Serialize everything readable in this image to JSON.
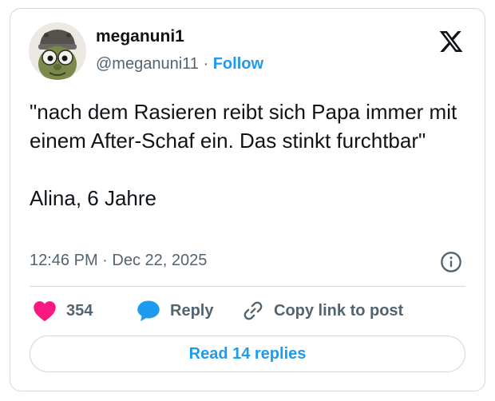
{
  "author": {
    "display_name": "meganuni1",
    "handle": "@meganuni11",
    "separator": "·",
    "follow_label": "Follow"
  },
  "tweet": {
    "text": "\"nach dem Rasieren reibt sich Papa immer mit einem After-Schaf ein. Das stinkt furchtbar\"\n\nAlina, 6 Jahre",
    "timestamp": "12:46 PM · Dec 22, 2025"
  },
  "actions": {
    "like_count": "354",
    "reply_label": "Reply",
    "copy_link_label": "Copy link to post"
  },
  "footer": {
    "read_replies_label": "Read 14 replies"
  },
  "icons": {
    "logo": "x-logo-icon",
    "info": "info-icon",
    "like": "heart-icon",
    "reply": "speech-bubble-icon",
    "link": "link-icon"
  },
  "colors": {
    "accent": "#1d9bf0",
    "like": "#f91880",
    "text": "#0f1419",
    "muted": "#536471",
    "border": "#cfd9de"
  }
}
